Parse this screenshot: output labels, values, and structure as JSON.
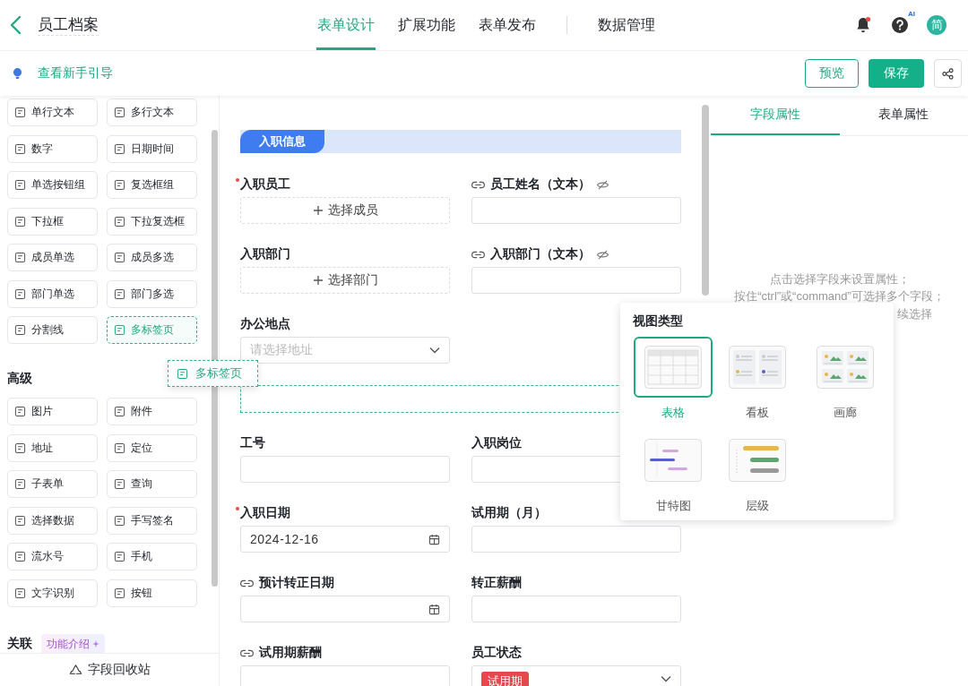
{
  "header": {
    "title": "员工档案",
    "tab_groups": [
      [
        {
          "label": "表单设计",
          "selected": true
        },
        {
          "label": "扩展功能",
          "selected": false
        },
        {
          "label": "表单发布",
          "selected": false
        }
      ],
      [
        {
          "label": "数据管理",
          "selected": false
        }
      ]
    ],
    "notification_dot": true,
    "help_badge": "AI",
    "avatar": "简"
  },
  "toolbar": {
    "guide_link": "查看新手引导",
    "buttons": [
      {
        "label": "预览",
        "kind": "outline"
      },
      {
        "label": "保存",
        "kind": "primary"
      },
      {
        "kind": "share"
      }
    ]
  },
  "palette": {
    "sections": [
      {
        "items": [
          {
            "label": "单行文本",
            "dragging": false
          },
          {
            "label": "多行文本",
            "dragging": false
          },
          {
            "label": "数字",
            "dragging": false
          },
          {
            "label": "日期时间",
            "dragging": false
          },
          {
            "label": "单选按钮组",
            "dragging": false
          },
          {
            "label": "复选框组",
            "dragging": false
          },
          {
            "label": "下拉框",
            "dragging": false
          },
          {
            "label": "下拉复选框",
            "dragging": false
          },
          {
            "label": "成员单选",
            "dragging": false
          },
          {
            "label": "成员多选",
            "dragging": false
          },
          {
            "label": "部门单选",
            "dragging": false
          },
          {
            "label": "部门多选",
            "dragging": false
          },
          {
            "label": "分割线",
            "dragging": false
          },
          {
            "label": "多标签页",
            "dragging": true
          }
        ]
      },
      {
        "title": "高级",
        "items": [
          {
            "label": "图片",
            "dragging": false
          },
          {
            "label": "附件",
            "dragging": false
          },
          {
            "label": "地址",
            "dragging": false
          },
          {
            "label": "定位",
            "dragging": false
          },
          {
            "label": "子表单",
            "dragging": false
          },
          {
            "label": "查询",
            "dragging": false
          },
          {
            "label": "选择数据",
            "dragging": false
          },
          {
            "label": "手写签名",
            "dragging": false
          },
          {
            "label": "流水号",
            "dragging": false
          },
          {
            "label": "手机",
            "dragging": false
          },
          {
            "label": "文字识别",
            "dragging": false
          },
          {
            "label": "按钮",
            "dragging": false
          }
        ]
      },
      {
        "title": "关联",
        "badge": "功能介绍"
      }
    ],
    "recycle": "字段回收站"
  },
  "drag_ghost": {
    "label": "多标签页"
  },
  "form": {
    "section": "入职信息",
    "fields": [
      {
        "label": "入职员工",
        "required": true,
        "linked": false,
        "hidden": false,
        "kind": "member",
        "action": "选择成员"
      },
      {
        "label": "员工姓名（文本）",
        "required": false,
        "linked": true,
        "hidden": true,
        "kind": "text"
      },
      {
        "label": "入职部门",
        "required": false,
        "linked": false,
        "hidden": false,
        "kind": "member",
        "action": "选择部门"
      },
      {
        "label": "入职部门（文本）",
        "required": false,
        "linked": true,
        "hidden": true,
        "kind": "text"
      },
      {
        "label": "办公地点",
        "required": false,
        "linked": false,
        "hidden": false,
        "kind": "select",
        "placeholder": "请选择地址"
      },
      {
        "kind": "drop-zone"
      },
      {
        "label": "工号",
        "required": false,
        "linked": false,
        "hidden": false,
        "kind": "text"
      },
      {
        "label": "入职岗位",
        "required": false,
        "linked": false,
        "hidden": false,
        "kind": "text"
      },
      {
        "label": "入职日期",
        "required": true,
        "linked": false,
        "hidden": false,
        "kind": "date",
        "value": "2024-12-16"
      },
      {
        "label": "试用期（月）",
        "required": false,
        "linked": false,
        "hidden": false,
        "kind": "text"
      },
      {
        "label": "预计转正日期",
        "required": false,
        "linked": true,
        "hidden": false,
        "kind": "date"
      },
      {
        "label": "转正薪酬",
        "required": false,
        "linked": false,
        "hidden": false,
        "kind": "text"
      },
      {
        "label": "试用期薪酬",
        "required": false,
        "linked": true,
        "hidden": false,
        "kind": "text"
      },
      {
        "label": "员工状态",
        "required": false,
        "linked": false,
        "hidden": false,
        "kind": "tag-select",
        "tag": "试用期"
      }
    ]
  },
  "properties": {
    "tabs": [
      {
        "label": "字段属性",
        "selected": true
      },
      {
        "label": "表单属性",
        "selected": false
      }
    ],
    "hint_lines": [
      "点击选择字段来设置属性；",
      "按住“ctrl”或“command”可选择多个字段；"
    ],
    "hint_tail": "续选择"
  },
  "view_popup": {
    "title": "视图类型",
    "options": [
      {
        "label": "表格",
        "kind": "table",
        "selected": true
      },
      {
        "label": "看板",
        "kind": "kanban",
        "selected": false
      },
      {
        "label": "画廊",
        "kind": "gallery",
        "selected": false
      },
      {
        "label": "甘特图",
        "kind": "gantt",
        "selected": false
      },
      {
        "label": "层级",
        "kind": "hierarchy",
        "selected": false
      }
    ]
  }
}
